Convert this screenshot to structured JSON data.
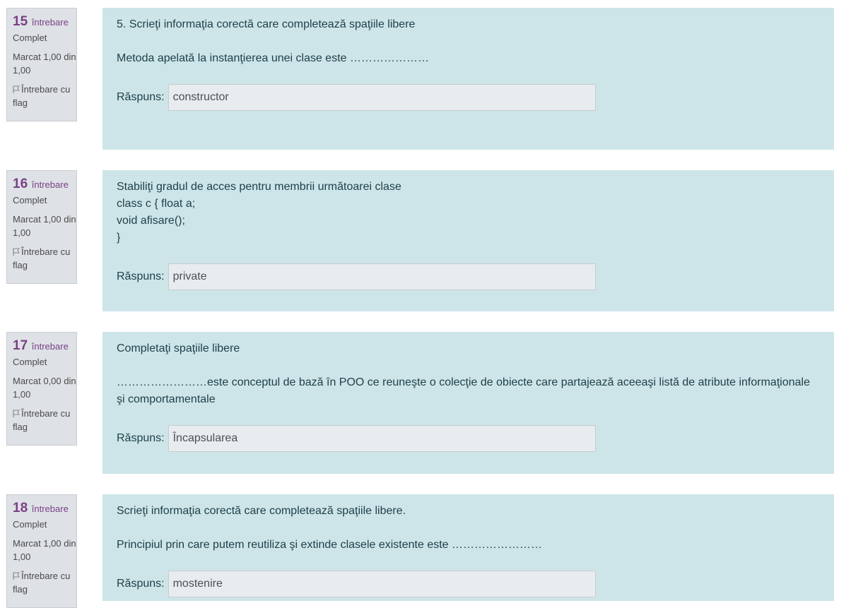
{
  "questions": [
    {
      "number": "15",
      "label": "întrebare",
      "state": "Complet",
      "grade": "Marcat 1,00 din 1,00",
      "flag": "Întrebare cu flag",
      "text": [
        "5. Scrieţi informaţia corectă care completează spaţiile libere",
        "Metoda apelată la instanţierea unei clase este …………………"
      ],
      "answer_label": "Răspuns:",
      "answer": "constructor"
    },
    {
      "number": "16",
      "label": "întrebare",
      "state": "Complet",
      "grade": "Marcat 1,00 din 1,00",
      "flag": "Întrebare cu flag",
      "text": [
        "Stabiliţi gradul de acces pentru membrii următoarei clase",
        "class c { float a;",
        "void afisare();",
        "}"
      ],
      "answer_label": "Răspuns:",
      "answer": "private"
    },
    {
      "number": "17",
      "label": "întrebare",
      "state": "Complet",
      "grade": "Marcat 0,00 din 1,00",
      "flag": "Întrebare cu flag",
      "text": [
        "Completaţi spaţiile libere",
        "……………………este conceptul de bază în POO ce reuneşte o colecţie de obiecte care partajează aceeaşi listă de atribute informaţionale şi comportamentale"
      ],
      "answer_label": "Răspuns:",
      "answer": "Încapsularea"
    },
    {
      "number": "18",
      "label": "întrebare",
      "state": "Complet",
      "grade": "Marcat 1,00 din 1,00",
      "flag": "Întrebare cu flag",
      "text": [
        "Scrieţi informaţia corectă care completează spaţiile libere.",
        "Principiul prin care putem reutiliza şi extinde clasele existente este ……………………"
      ],
      "answer_label": "Răspuns:",
      "answer": "mostenire"
    }
  ],
  "colors": {
    "info_bg": "#dee2e6",
    "content_bg": "#cde5e8",
    "question_number": "#7b3f86",
    "input_bg": "#e9ecef"
  },
  "icons": {
    "flag": "flag-icon"
  }
}
